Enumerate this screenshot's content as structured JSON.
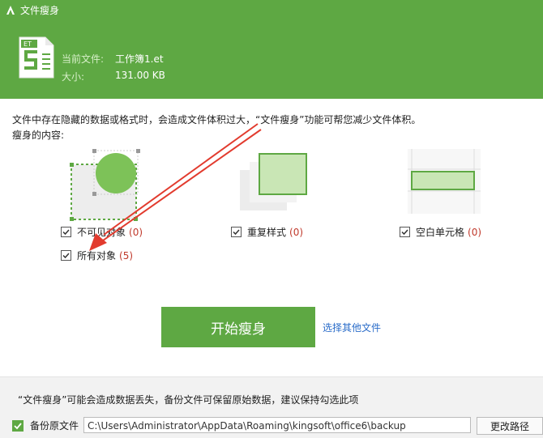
{
  "window": {
    "title": "文件瘦身"
  },
  "file_info": {
    "current_label": "当前文件:",
    "current_value": "工作簿1.et",
    "size_label": "大小:",
    "size_value": "131.00 KB",
    "icon_badge": "ET"
  },
  "description": "文件中存在隐藏的数据或格式时，会造成文件体积过大，“文件瘦身”功能可帮您减少文件体积。",
  "content_label": "瘦身的内容:",
  "options": [
    {
      "label": "不可见对象",
      "count": "(0)",
      "checked": true
    },
    {
      "label": "重复样式",
      "count": "(0)",
      "checked": true
    },
    {
      "label": "空白单元格",
      "count": "(0)",
      "checked": true
    },
    {
      "label": "所有对象",
      "count": "(5)",
      "checked": true
    }
  ],
  "start_button": "开始瘦身",
  "other_file_link": "选择其他文件",
  "footer": {
    "warning": "“文件瘦身”可能会造成数据丢失，备份文件可保留原始数据，建议保持勾选此项",
    "backup_label": "备份原文件",
    "backup_path": "C:\\Users\\Administrator\\AppData\\Roaming\\kingsoft\\office6\\backup",
    "change_path_button": "更改路径"
  },
  "colors": {
    "brand_green": "#5ea843",
    "count_red": "#c0392b",
    "link_blue": "#2a6cc9",
    "annotation_red": "#e23b2e"
  }
}
